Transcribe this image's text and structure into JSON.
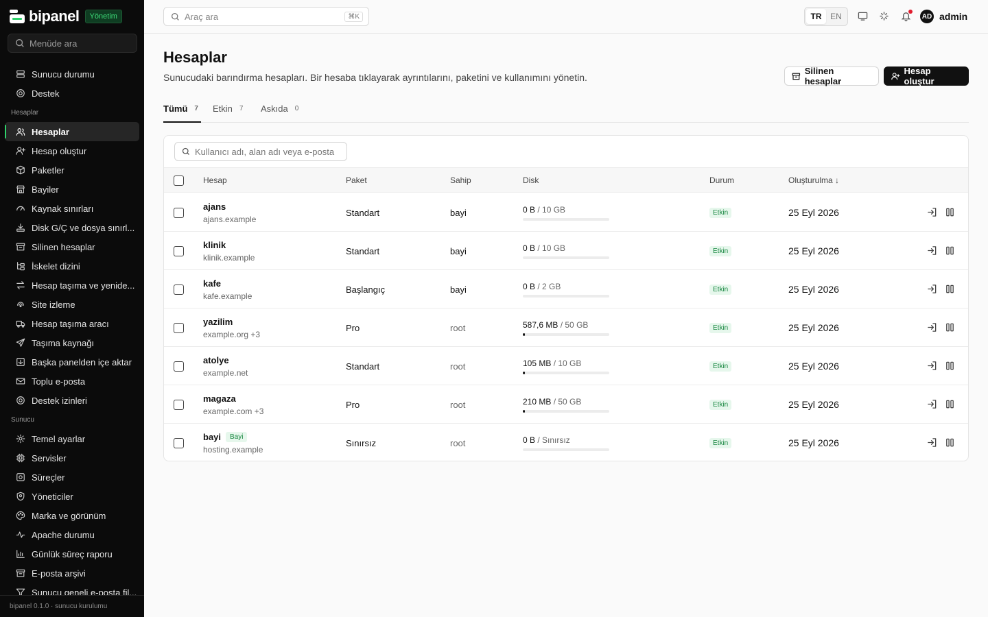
{
  "brand": {
    "name": "bipanel",
    "badge": "Yönetim",
    "accent": "#2fd36b"
  },
  "sidebar": {
    "search_placeholder": "Menüde ara",
    "top_items": [
      {
        "label": "Sunucu durumu",
        "icon": "server-icon"
      },
      {
        "label": "Destek",
        "icon": "lifebuoy-icon"
      }
    ],
    "section_accounts": "Hesaplar",
    "account_items": [
      {
        "label": "Hesaplar",
        "icon": "users-icon",
        "active": true
      },
      {
        "label": "Hesap oluştur",
        "icon": "user-plus-icon"
      },
      {
        "label": "Paketler",
        "icon": "package-icon"
      },
      {
        "label": "Bayiler",
        "icon": "store-icon"
      },
      {
        "label": "Kaynak sınırları",
        "icon": "gauge-icon"
      },
      {
        "label": "Disk G/Ç ve dosya sınırl...",
        "icon": "disk-io-icon"
      },
      {
        "label": "Silinen hesaplar",
        "icon": "archive-icon"
      },
      {
        "label": "İskelet dizini",
        "icon": "folder-tree-icon"
      },
      {
        "label": "Hesap taşıma ve yenide...",
        "icon": "arrows-exchange-icon"
      },
      {
        "label": "Site izleme",
        "icon": "radar-icon"
      },
      {
        "label": "Hesap taşıma aracı",
        "icon": "truck-icon"
      },
      {
        "label": "Taşıma kaynağı",
        "icon": "send-icon"
      },
      {
        "label": "Başka panelden içe aktar",
        "icon": "import-icon"
      },
      {
        "label": "Toplu e-posta",
        "icon": "mail-icon"
      },
      {
        "label": "Destek izinleri",
        "icon": "lifebuoy-icon"
      }
    ],
    "section_server": "Sunucu",
    "server_items": [
      {
        "label": "Temel ayarlar",
        "icon": "gear-icon"
      },
      {
        "label": "Servisler",
        "icon": "cpu-icon"
      },
      {
        "label": "Süreçler",
        "icon": "process-icon"
      },
      {
        "label": "Yöneticiler",
        "icon": "shield-user-icon"
      },
      {
        "label": "Marka ve görünüm",
        "icon": "palette-icon"
      },
      {
        "label": "Apache durumu",
        "icon": "activity-icon"
      },
      {
        "label": "Günlük süreç raporu",
        "icon": "bar-chart-icon"
      },
      {
        "label": "E-posta arşivi",
        "icon": "archive-icon"
      },
      {
        "label": "Sunucu geneli e-posta fil...",
        "icon": "filter-icon"
      }
    ],
    "footer": "bipanel 0.1.0 · sunucu kurulumu"
  },
  "topbar": {
    "search_placeholder": "Araç ara",
    "shortcut": "⌘K",
    "lang_tr": "TR",
    "lang_en": "EN",
    "avatar_initials": "AD",
    "username": "admin"
  },
  "page": {
    "title": "Hesaplar",
    "description": "Sunucudaki barındırma hesapları. Bir hesaba tıklayarak ayrıntılarını, paketini ve kullanımını yönetin.",
    "deleted_button": "Silinen hesaplar",
    "create_button": "Hesap oluştur"
  },
  "tabs": [
    {
      "label": "Tümü",
      "count": "7"
    },
    {
      "label": "Etkin",
      "count": "7"
    },
    {
      "label": "Askıda",
      "count": "0"
    }
  ],
  "table": {
    "filter_placeholder": "Kullanıcı adı, alan adı veya e-posta",
    "columns": {
      "account": "Hesap",
      "package": "Paket",
      "owner": "Sahip",
      "disk": "Disk",
      "status": "Durum",
      "created": "Oluşturulma ↓"
    },
    "rows": [
      {
        "name": "ajans",
        "domain": "ajans.example",
        "package": "Standart",
        "owner": "bayi",
        "owner_muted": false,
        "disk_used": "0 B",
        "disk_limit": "/ 10 GB",
        "disk_fraction": 0,
        "status": "Etkin",
        "created": "25 Eyl 2026",
        "badge": ""
      },
      {
        "name": "klinik",
        "domain": "klinik.example",
        "package": "Standart",
        "owner": "bayi",
        "owner_muted": false,
        "disk_used": "0 B",
        "disk_limit": "/ 10 GB",
        "disk_fraction": 0,
        "status": "Etkin",
        "created": "25 Eyl 2026",
        "badge": ""
      },
      {
        "name": "kafe",
        "domain": "kafe.example",
        "package": "Başlangıç",
        "owner": "bayi",
        "owner_muted": false,
        "disk_used": "0 B",
        "disk_limit": "/ 2 GB",
        "disk_fraction": 0,
        "status": "Etkin",
        "created": "25 Eyl 2026",
        "badge": ""
      },
      {
        "name": "yazilim",
        "domain": "example.org +3",
        "package": "Pro",
        "owner": "root",
        "owner_muted": true,
        "disk_used": "587,6 MB",
        "disk_limit": "/ 50 GB",
        "disk_fraction": 0.012,
        "status": "Etkin",
        "created": "25 Eyl 2026",
        "badge": ""
      },
      {
        "name": "atolye",
        "domain": "example.net",
        "package": "Standart",
        "owner": "root",
        "owner_muted": true,
        "disk_used": "105 MB",
        "disk_limit": "/ 10 GB",
        "disk_fraction": 0.01,
        "status": "Etkin",
        "created": "25 Eyl 2026",
        "badge": ""
      },
      {
        "name": "magaza",
        "domain": "example.com +3",
        "package": "Pro",
        "owner": "root",
        "owner_muted": true,
        "disk_used": "210 MB",
        "disk_limit": "/ 50 GB",
        "disk_fraction": 0.004,
        "status": "Etkin",
        "created": "25 Eyl 2026",
        "badge": ""
      },
      {
        "name": "bayi",
        "domain": "hosting.example",
        "package": "Sınırsız",
        "owner": "root",
        "owner_muted": true,
        "disk_used": "0 B",
        "disk_limit": "/ Sınırsız",
        "disk_fraction": 0,
        "status": "Etkin",
        "created": "25 Eyl 2026",
        "badge": "Bayi"
      }
    ],
    "row_actions": [
      "login-icon",
      "pause-icon"
    ]
  }
}
